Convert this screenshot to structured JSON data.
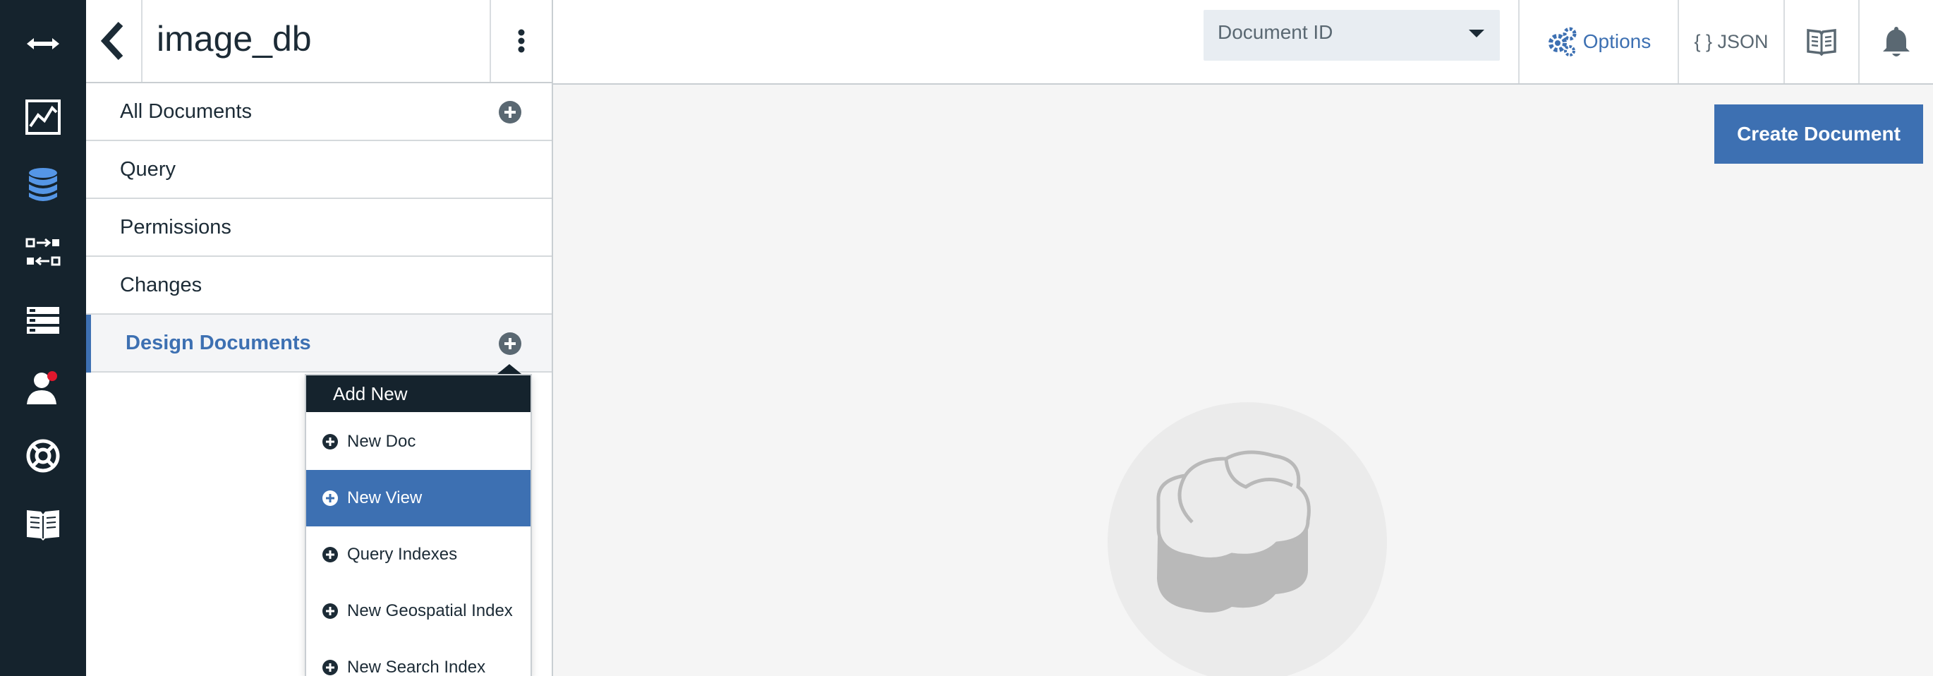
{
  "rail": {
    "items": [
      {
        "icon": "expand-arrows-icon"
      },
      {
        "icon": "activity-chart-icon"
      },
      {
        "icon": "database-icon",
        "active": true
      },
      {
        "icon": "replication-icon"
      },
      {
        "icon": "server-list-icon"
      },
      {
        "icon": "user-icon",
        "badge": true
      },
      {
        "icon": "support-icon"
      },
      {
        "icon": "documentation-book-icon"
      }
    ],
    "colors": {
      "background": "#15232d",
      "active": "#5596e6",
      "badge": "#e0182d"
    }
  },
  "sidebar": {
    "database_name": "image_db",
    "nav": {
      "all_documents": "All Documents",
      "query": "Query",
      "permissions": "Permissions",
      "changes": "Changes",
      "design_documents": "Design Documents"
    },
    "active_item": "Design Documents"
  },
  "add_new_menu": {
    "header": "Add New",
    "items": [
      {
        "label": "New Doc",
        "selected": false
      },
      {
        "label": "New View",
        "selected": true
      },
      {
        "label": "Query Indexes",
        "selected": false
      },
      {
        "label": "New Geospatial Index",
        "selected": false
      },
      {
        "label": "New Search Index",
        "selected": false
      }
    ]
  },
  "topbar": {
    "select": {
      "value": "Document ID"
    },
    "options_label": "Options",
    "json_label": "{ } JSON"
  },
  "main": {
    "create_document_label": "Create Document"
  },
  "colors": {
    "accent": "#3d70b2",
    "text": "#1c2b36",
    "muted": "#5a6872"
  }
}
